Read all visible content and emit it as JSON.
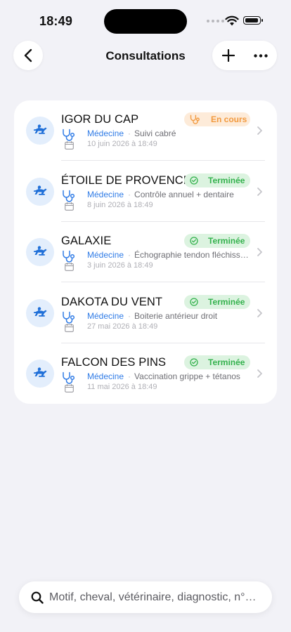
{
  "status_bar": {
    "time": "18:49"
  },
  "nav": {
    "title": "Consultations",
    "back_icon": "chevron-left-icon",
    "add_icon": "plus-icon",
    "more_icon": "ellipsis-icon"
  },
  "colors": {
    "accent_blue": "#2f7be6",
    "in_progress": "#f29a3f",
    "done": "#35b24e"
  },
  "consultations": [
    {
      "horse": "IGOR DU CAP",
      "status": "En cours",
      "status_kind": "en-cours",
      "type": "Médecine",
      "separator": "·",
      "motif": "Suivi cabré",
      "date": "10 juin 2026 à 18:49"
    },
    {
      "horse": "ÉTOILE DE PROVENCE",
      "status": "Terminée",
      "status_kind": "terminee",
      "type": "Médecine",
      "separator": "·",
      "motif": "Contrôle annuel + dentaire",
      "date": "8 juin 2026 à 18:49"
    },
    {
      "horse": "GALAXIE",
      "status": "Terminée",
      "status_kind": "terminee",
      "type": "Médecine",
      "separator": "·",
      "motif": "Échographie tendon fléchiss…",
      "date": "3 juin 2026 à 18:49"
    },
    {
      "horse": "DAKOTA DU VENT",
      "status": "Terminée",
      "status_kind": "terminee",
      "type": "Médecine",
      "separator": "·",
      "motif": "Boiterie antérieur droit",
      "date": "27 mai 2026 à 18:49"
    },
    {
      "horse": "FALCON DES PINS",
      "status": "Terminée",
      "status_kind": "terminee",
      "type": "Médecine",
      "separator": "·",
      "motif": "Vaccination grippe + tétanos",
      "date": "11 mai 2026 à 18:49"
    }
  ],
  "search": {
    "placeholder": "Motif, cheval, vétérinaire, diagnostic, n°…",
    "value": ""
  }
}
